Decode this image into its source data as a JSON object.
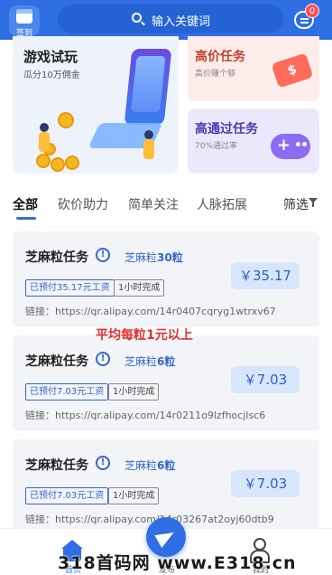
{
  "header": {
    "checkin_label": "签到",
    "search_placeholder": "输入关键词",
    "message_badge": "0"
  },
  "banners": {
    "main": {
      "title": "游戏试玩",
      "subtitle": "瓜分10万佣金"
    },
    "high_price": {
      "title": "高价任务",
      "subtitle": "高价赚个够",
      "icon": "dollar-tag-icon"
    },
    "high_pass": {
      "title": "高通过任务",
      "subtitle": "70%通过率",
      "icon": "gamepad-icon"
    }
  },
  "tabs": [
    "全部",
    "砍价助力",
    "简单关注",
    "人脉拓展"
  ],
  "active_tab": 0,
  "filter_label": "筛选",
  "tasks": [
    {
      "title": "芝麻粒任务",
      "grain_prefix": "芝麻粒",
      "grain_count": "30粒",
      "prepaid": "已预付35.17元工资",
      "time": "1小时完成",
      "link": "链接：https://qr.alipay.com/14r0407cqryg1wtrxv67",
      "price": "￥35.17"
    },
    {
      "title": "芝麻粒任务",
      "grain_prefix": "芝麻粒",
      "grain_count": "6粒",
      "prepaid": "已预付7.03元工资",
      "time": "1小时完成",
      "link": "链接：https://qr.alipay.com/14r0211o9lzfhocjlsc6",
      "price": "￥7.03"
    },
    {
      "title": "芝麻粒任务",
      "grain_prefix": "芝麻粒",
      "grain_count": "6粒",
      "prepaid": "已预付7.03元工资",
      "time": "1小时完成",
      "link": "链接：https://qr.alipay.com/14r03267at2oyj60dtb9",
      "price": "￥7.03"
    }
  ],
  "overlay_text": "平均每粒1元以上",
  "bottom_nav": {
    "home": "首页",
    "publish": "发布",
    "me": "我的"
  },
  "watermark": "318首码网 www.E318.cn",
  "colors": {
    "primary": "#2f6ee3",
    "price_bg": "#d8e6fb",
    "overlay_red": "#e3302f"
  }
}
